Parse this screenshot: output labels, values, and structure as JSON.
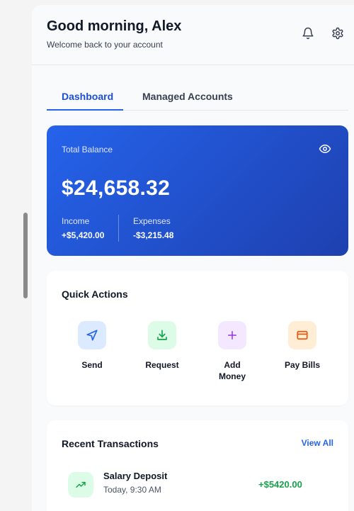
{
  "header": {
    "greeting": "Good morning, Alex",
    "subtitle": "Welcome back to your account",
    "icons": [
      "bell-icon",
      "gear-icon"
    ]
  },
  "tabs": [
    {
      "label": "Dashboard",
      "active": true
    },
    {
      "label": "Managed Accounts",
      "active": false
    }
  ],
  "balance": {
    "label": "Total Balance",
    "amount": "$24,658.32",
    "income_label": "Income",
    "income_value": "+$5,420.00",
    "expenses_label": "Expenses",
    "expenses_value": "-$3,215.48",
    "visibility_icon": "eye-icon"
  },
  "quick_actions": {
    "title": "Quick Actions",
    "items": [
      {
        "label": "Send",
        "icon": "send-icon",
        "color": "#2563eb",
        "bg": "#dbeafe"
      },
      {
        "label": "Request",
        "icon": "download-icon",
        "color": "#16a34a",
        "bg": "#dcfce7"
      },
      {
        "label": "Add\nMoney",
        "icon": "plus-icon",
        "color": "#9333ea",
        "bg": "#f3e8ff"
      },
      {
        "label": "Pay Bills",
        "icon": "card-icon",
        "color": "#ea580c",
        "bg": "#ffedd5"
      }
    ]
  },
  "transactions": {
    "title": "Recent Transactions",
    "view_all": "View All",
    "items": [
      {
        "name": "Salary Deposit",
        "time": "Today, 9:30 AM",
        "amount": "+$5420.00",
        "icon": "trending-up-icon"
      }
    ]
  },
  "colors": {
    "accent": "#2563eb",
    "positive": "#16a34a"
  }
}
